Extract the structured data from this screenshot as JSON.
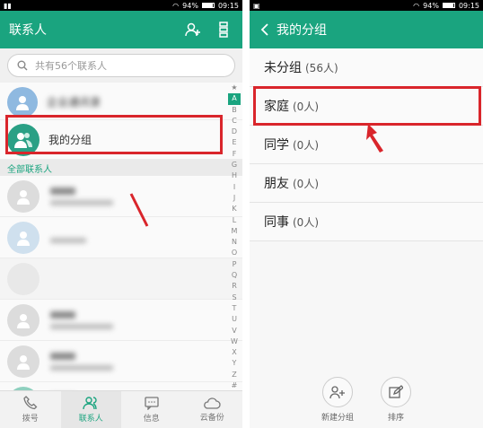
{
  "left": {
    "status": {
      "battery": "94%",
      "time": "09:15"
    },
    "header": {
      "title": "联系人"
    },
    "search": {
      "placeholder": "共有56个联系人"
    },
    "top_items": [
      {
        "label": "企业通讯录"
      },
      {
        "label": "我的分组"
      }
    ],
    "section_label": "全部联系人",
    "index_letters": [
      "★",
      "A",
      "B",
      "C",
      "D",
      "E",
      "F",
      "G",
      "H",
      "I",
      "J",
      "K",
      "L",
      "M",
      "N",
      "O",
      "P",
      "Q",
      "R",
      "S",
      "T",
      "U",
      "V",
      "W",
      "X",
      "Y",
      "Z",
      "#"
    ],
    "bottom_nav": [
      {
        "label": "拨号",
        "icon": "phone-icon"
      },
      {
        "label": "联系人",
        "icon": "contacts-icon"
      },
      {
        "label": "信息",
        "icon": "message-icon"
      },
      {
        "label": "云备份",
        "icon": "cloud-icon"
      }
    ]
  },
  "right": {
    "status": {
      "battery": "94%",
      "time": "09:15"
    },
    "header": {
      "title": "我的分组"
    },
    "groups": [
      {
        "name": "未分组",
        "count": "(56人)"
      },
      {
        "name": "家庭",
        "count": "(0人)"
      },
      {
        "name": "同学",
        "count": "(0人)"
      },
      {
        "name": "朋友",
        "count": "(0人)"
      },
      {
        "name": "同事",
        "count": "(0人)"
      }
    ],
    "actions": [
      {
        "label": "新建分组",
        "icon": "add-group-icon"
      },
      {
        "label": "排序",
        "icon": "edit-icon"
      }
    ]
  },
  "colors": {
    "accent": "#1aa47f",
    "annotation": "#d9252b"
  }
}
